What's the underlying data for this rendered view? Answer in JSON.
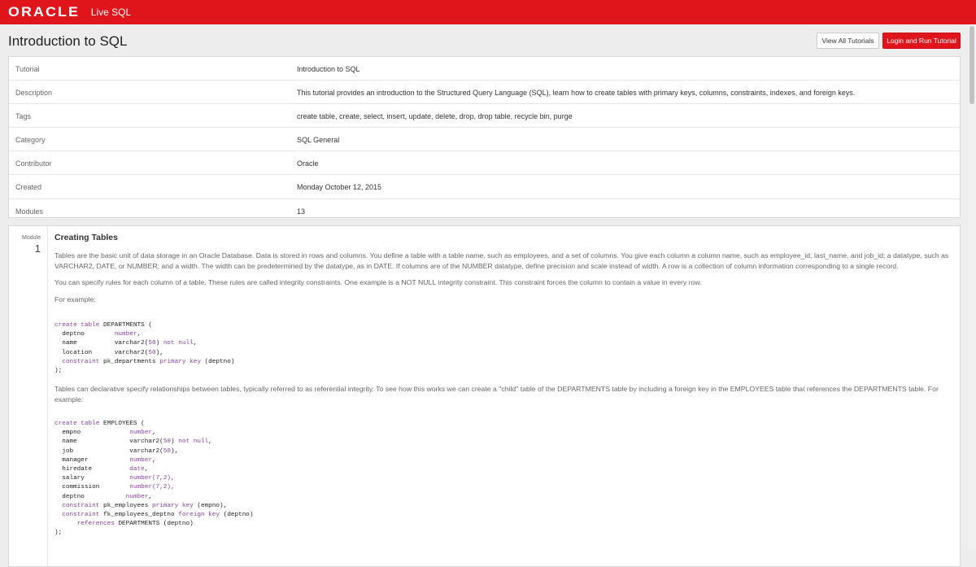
{
  "topbar": {
    "logo": "ORACLE",
    "product": "Live SQL"
  },
  "header": {
    "title": "Introduction to SQL",
    "view_all_label": "View All Tutorials",
    "login_label": "Login and Run Tutorial"
  },
  "info": [
    {
      "label": "Tutorial",
      "value": "Introduction to SQL"
    },
    {
      "label": "Description",
      "value": "This tutorial provides an introduction to the Structured Query Language (SQL), learn how to create tables with primary keys, columns, constraints, indexes, and foreign keys."
    },
    {
      "label": "Tags",
      "value": "create table, create, select, insert, update, delete, drop, drop table, recycle bin, purge"
    },
    {
      "label": "Category",
      "value": "SQL General"
    },
    {
      "label": "Contributor",
      "value": "Oracle"
    },
    {
      "label": "Created",
      "value": "Monday October 12, 2015"
    },
    {
      "label": "Modules",
      "value": "13"
    }
  ],
  "module": {
    "label": "Module",
    "number": "1",
    "title": "Creating Tables",
    "paragraphs": [
      "Tables are the basic unit of data storage in an Oracle Database. Data is stored in rows and columns. You define a table with a table name, such as employees, and a set of columns. You give each column a column name, such as employee_id, last_name, and job_id; a datatype, such as VARCHAR2, DATE, or NUMBER; and a width. The width can be predetermined by the datatype, as in DATE. If columns are of the NUMBER datatype, define precision and scale instead of width. A row is a collection of column information corresponding to a single record.",
      "You can specify rules for each column of a table. These rules are called integrity constraints. One example is a NOT NULL integrity constraint. This constraint forces the column to contain a value in every row.",
      "For example:",
      "Tables can declarative specify relationships between tables, typically referred to as referential integrity. To see how this works we can create a \"child\" table of the DEPARTMENTS table by including a foreign key in the EMPLOYEES table that references the DEPARTMENTS table. For example:"
    ]
  },
  "code_blocks": {
    "departments": {
      "l1a": "create table",
      "l1b": " DEPARTMENTS (",
      "l2a": "  deptno        ",
      "l2b": "number",
      "l2c": ",",
      "l3a": "  name          ",
      "l3b": "varchar2(",
      "l3c": "50",
      "l3d": ") ",
      "l3e": "not null",
      "l3f": ",",
      "l4a": "  location      ",
      "l4b": "varchar2(",
      "l4c": "50",
      "l4d": "),",
      "l5a": "  ",
      "l5b": "constraint",
      "l5c": " pk_departments ",
      "l5d": "primary key",
      "l5e": " (deptno)",
      "l6": ");"
    },
    "employees": {
      "l1a": "create table",
      "l1b": " EMPLOYEES (",
      "l2a": "  empno             ",
      "l2b": "number",
      "l2c": ",",
      "l3a": "  name              ",
      "l3b": "varchar2(",
      "l3c": "50",
      "l3d": ") ",
      "l3e": "not null",
      "l3f": ",",
      "l4a": "  job               ",
      "l4b": "varchar2(",
      "l4c": "50",
      "l4d": "),",
      "l5a": "  manager           ",
      "l5b": "number",
      "l5c": ",",
      "l6a": "  hiredate          ",
      "l6b": "date",
      "l6c": ",",
      "l7a": "  salary            ",
      "l7b": "number(",
      "l7c": "7,2",
      "l7d": "),",
      "l8a": "  commission        ",
      "l8b": "number(",
      "l8c": "7,2",
      "l8d": "),",
      "l9a": "  deptno           ",
      "l9b": "number",
      "l9c": ",",
      "l10a": "  ",
      "l10b": "constraint",
      "l10c": " pk_employees ",
      "l10d": "primary key",
      "l10e": " (empno),",
      "l11a": "  ",
      "l11b": "constraint",
      "l11c": " fk_employees_deptno ",
      "l11d": "foreign key",
      "l11e": " (deptno)",
      "l12a": "      ",
      "l12b": "references",
      "l12c": " DEPARTMENTS (deptno)",
      "l13": ");"
    }
  },
  "colors": {
    "brand_red": "#e0141b",
    "keyword_purple": "#8a3fa0"
  }
}
